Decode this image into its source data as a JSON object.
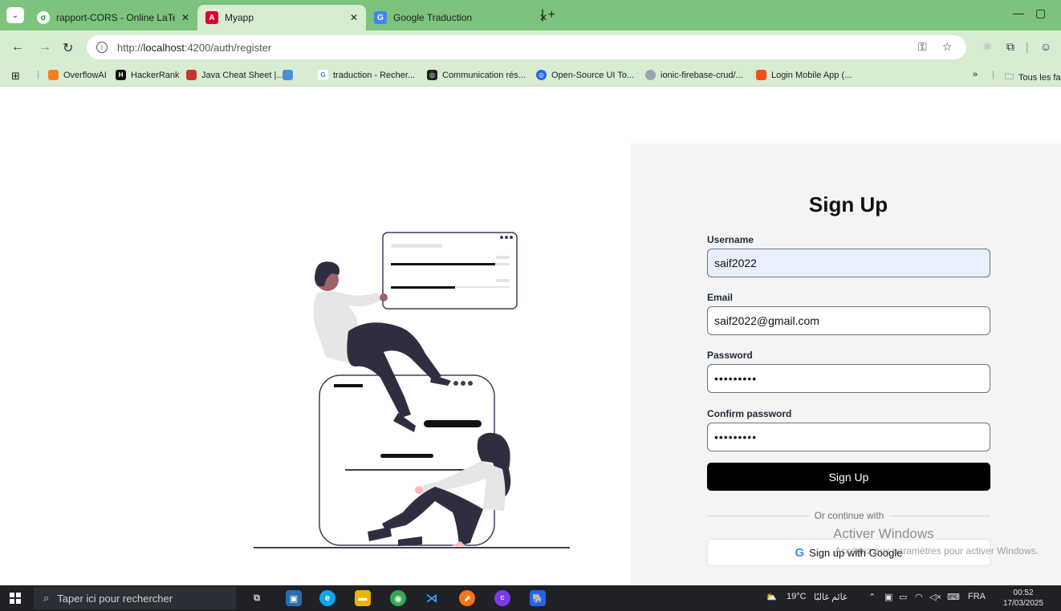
{
  "browser": {
    "tabs": [
      {
        "title": "rapport-CORS - Online LaTeX Ed",
        "favicon": "overleaf-icon"
      },
      {
        "title": "Myapp",
        "favicon": "angular-icon"
      },
      {
        "title": "Google Traduction",
        "favicon": "google-translate-icon"
      }
    ],
    "active_tab": 1,
    "url_prefix": "http://",
    "url_host": "localhost",
    "url_path": ":4200/auth/register",
    "bookmarks": [
      {
        "label": "OverflowAI",
        "icon": "overflowai-icon",
        "color": "#f48024"
      },
      {
        "label": "HackerRank",
        "icon": "hackerrank-icon",
        "color": "#1ba94c"
      },
      {
        "label": "Java Cheat Sheet |...",
        "icon": "book-icon",
        "color": "#c0392b"
      },
      {
        "label": "traduction - Recher...",
        "icon": "google-icon",
        "color": "#4285f4"
      },
      {
        "label": "Communication rés...",
        "icon": "chatgpt-icon",
        "color": "#222222"
      },
      {
        "label": "Open-Source UI To...",
        "icon": "target-icon",
        "color": "#2563eb"
      },
      {
        "label": "ionic-firebase-crud/...",
        "icon": "github-icon",
        "color": "#6b7280"
      },
      {
        "label": "Login Mobile App (...",
        "icon": "figma-icon",
        "color": "#f24e1e"
      }
    ],
    "all_bookmarks_label": "Tous les fa"
  },
  "form": {
    "title": "Sign Up",
    "username_label": "Username",
    "username_value": "saif2022",
    "email_label": "Email",
    "email_value": "saif2022@gmail.com",
    "password_label": "Password",
    "password_value": "•••••••••",
    "confirm_label": "Confirm password",
    "confirm_value": "•••••••••",
    "submit_label": "Sign Up",
    "divider_text": "Or continue with",
    "google_label": "Sign up with Google"
  },
  "watermark": {
    "line1": "Activer Windows",
    "line2": "Accédez aux paramètres pour activer Windows."
  },
  "taskbar": {
    "search_placeholder": "Taper ici pour rechercher",
    "weather": "19°C",
    "weather_text": "غائم غالبًا",
    "language": "FRA",
    "time": "00:52",
    "date": "17/03/2025"
  },
  "colors": {
    "tab_strip": "#7dc27d",
    "toolbar": "#d7ecd1",
    "panel": "#f3f4f6",
    "primary_button": "#000000"
  }
}
